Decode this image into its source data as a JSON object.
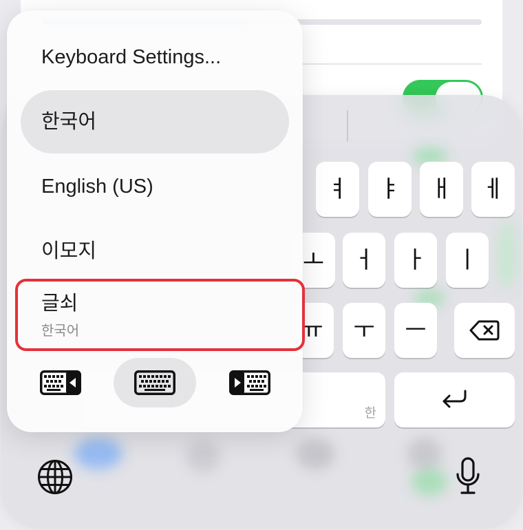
{
  "menu": {
    "settings_label": "Keyboard Settings...",
    "languages": [
      {
        "label": "한국어",
        "selected": true
      },
      {
        "label": "English (US)",
        "selected": false
      },
      {
        "label": "이모지",
        "selected": false
      }
    ],
    "keyboard_item": {
      "label": "글쇠",
      "subtitle": "한국어",
      "highlighted": true
    },
    "layout_options": [
      {
        "icon": "keyboard-left-icon",
        "selected": false
      },
      {
        "icon": "keyboard-icon",
        "selected": true
      },
      {
        "icon": "keyboard-right-icon",
        "selected": false
      }
    ]
  },
  "keyboard": {
    "rows": [
      [
        "ㅕ",
        "ㅑ",
        "ㅐ",
        "ㅔ"
      ],
      [
        "ㅗ",
        "ㅓ",
        "ㅏ",
        "ㅣ"
      ],
      [
        "ㅠ",
        "ㅜ",
        "ㅡ"
      ]
    ],
    "space_hint": "한",
    "icons": {
      "backspace": "delete-left-icon",
      "return": "return-icon",
      "globe": "globe-icon",
      "dictation": "microphone-icon"
    }
  },
  "settings_toggle": {
    "on": true
  },
  "colors": {
    "highlight_outline": "#e4313a",
    "selected_fill": "#e5e5e8",
    "toggle_green": "#34c759",
    "key_fill": "#ffffff",
    "text_primary": "#1c1c1e",
    "text_secondary": "#8a8a8e"
  }
}
